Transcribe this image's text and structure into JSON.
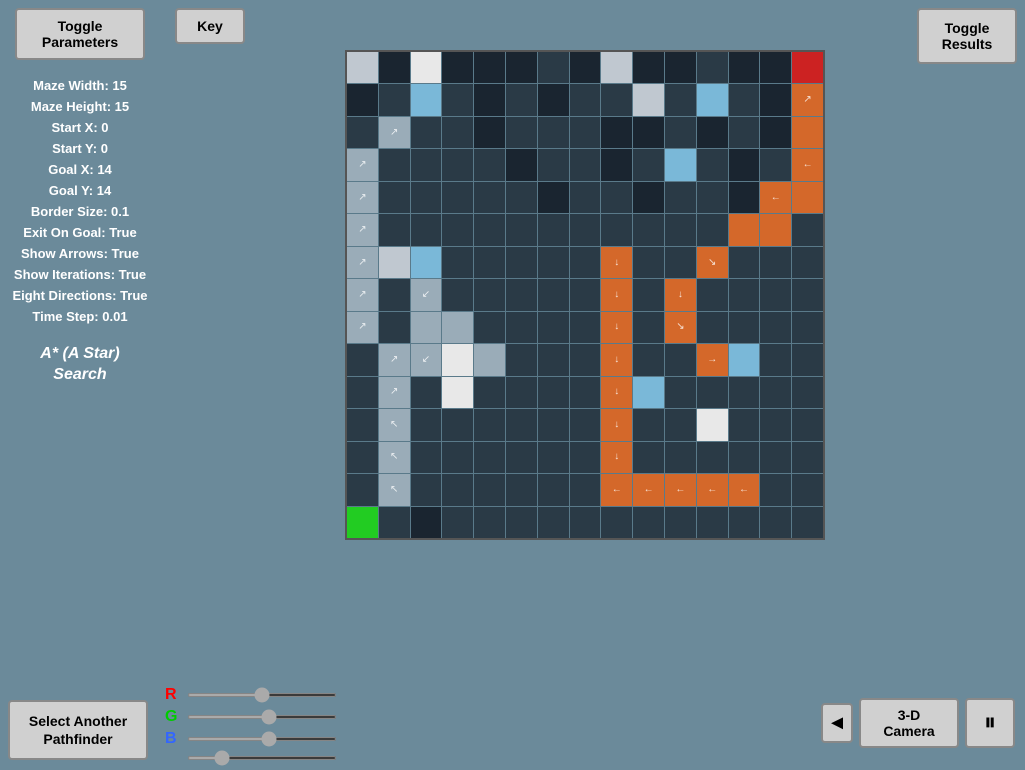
{
  "sidebar": {
    "toggle_params_label": "Toggle\nParameters",
    "params": [
      {
        "label": "Maze Width: 15"
      },
      {
        "label": "Maze Height: 15"
      },
      {
        "label": "Start X: 0"
      },
      {
        "label": "Start Y: 0"
      },
      {
        "label": "Goal X: 14"
      },
      {
        "label": "Goal Y: 14"
      },
      {
        "label": "Border Size: 0.1"
      },
      {
        "label": "Exit On Goal: True"
      },
      {
        "label": "Show Arrows: True"
      },
      {
        "label": "Show Iterations: True"
      },
      {
        "label": "Eight Directions: True"
      },
      {
        "label": "Time Step: 0.01"
      }
    ],
    "algorithm_label": "A* (A Star)\nSearch",
    "select_pathfinder_label": "Select Another\nPathfinder"
  },
  "header": {
    "key_label": "Key",
    "toggle_results_label": "Toggle\nResults"
  },
  "bottom": {
    "rgb": {
      "r_label": "R",
      "g_label": "G",
      "b_label": "B",
      "r_value": 50,
      "g_value": 55,
      "b_value": 55,
      "fourth_value": 20
    },
    "camera_btn_label": "3-D\nCamera",
    "pause_icon": "⏸",
    "back_icon": "◄"
  },
  "maze": {
    "cols": 15,
    "rows": 15,
    "cells": [
      "dark",
      "black",
      "white",
      "black",
      "black",
      "black",
      "dark",
      "black",
      "light",
      "black",
      "black",
      "dark",
      "black",
      "black",
      "red",
      "black",
      "dark",
      "blue",
      "dark",
      "black",
      "dark",
      "black",
      "dark",
      "dark",
      "light",
      "dark",
      "blue",
      "dark",
      "black",
      "orange-arrow-ne",
      "dark",
      "light",
      "dark",
      "dark",
      "black",
      "dark",
      "dark",
      "dark",
      "black",
      "black",
      "dark",
      "black",
      "dark",
      "black",
      "orange",
      "dark",
      "dark",
      "dark",
      "dark",
      "dark",
      "black",
      "dark",
      "dark",
      "black",
      "dark",
      "blue",
      "dark",
      "black",
      "dark",
      "orange-arrow-w",
      "dark",
      "dark",
      "dark",
      "dark",
      "dark",
      "dark",
      "black",
      "dark",
      "dark",
      "black",
      "dark",
      "dark",
      "black",
      "orange-arrow-w",
      "orange",
      "dark",
      "dark",
      "dark",
      "dark",
      "dark",
      "dark",
      "dark",
      "dark",
      "dark",
      "dark",
      "dark",
      "dark",
      "orange",
      "orange",
      "dark",
      "dark",
      "light",
      "blue",
      "dark",
      "dark",
      "dark",
      "dark",
      "dark",
      "orange-arrow-s",
      "dark",
      "dark",
      "orange-arrow-se",
      "dark",
      "dark",
      "dark",
      "dark",
      "dark",
      "dark",
      "dark",
      "dark",
      "dark",
      "dark",
      "dark",
      "orange-arrow-s",
      "dark",
      "orange-arrow-s",
      "dark",
      "dark",
      "dark",
      "dark",
      "dark",
      "dark",
      "gray",
      "gray",
      "dark",
      "dark",
      "dark",
      "dark",
      "orange-arrow-s",
      "dark",
      "orange-arrow-se",
      "dark",
      "dark",
      "dark",
      "dark",
      "dark",
      "dark",
      "gray",
      "white",
      "gray",
      "dark",
      "dark",
      "dark",
      "orange-arrow-s",
      "dark",
      "dark",
      "orange-arrow-e",
      "dark",
      "dark",
      "dark",
      "dark",
      "dark",
      "dark",
      "white",
      "dark",
      "dark",
      "dark",
      "dark",
      "orange-arrow-s",
      "blue",
      "dark",
      "dark",
      "dark",
      "dark",
      "dark",
      "dark",
      "dark",
      "dark",
      "dark",
      "dark",
      "dark",
      "dark",
      "dark",
      "orange-arrow-s",
      "dark",
      "dark",
      "white",
      "dark",
      "dark",
      "dark",
      "dark",
      "dark",
      "dark",
      "dark",
      "dark",
      "dark",
      "dark",
      "dark",
      "orange-arrow-s",
      "dark",
      "dark",
      "dark",
      "dark",
      "dark",
      "dark",
      "dark",
      "dark",
      "dark",
      "dark",
      "dark",
      "dark",
      "dark",
      "dark",
      "orange-arrow-w",
      "orange-arrow-w",
      "orange-arrow-w",
      "orange-arrow-w",
      "orange-arrow-w",
      "dark",
      "dark",
      "green",
      "dark",
      "black",
      "dark",
      "dark",
      "dark",
      "dark",
      "dark",
      "dark",
      "dark",
      "dark",
      "dark",
      "dark",
      "dark",
      "dark"
    ]
  }
}
